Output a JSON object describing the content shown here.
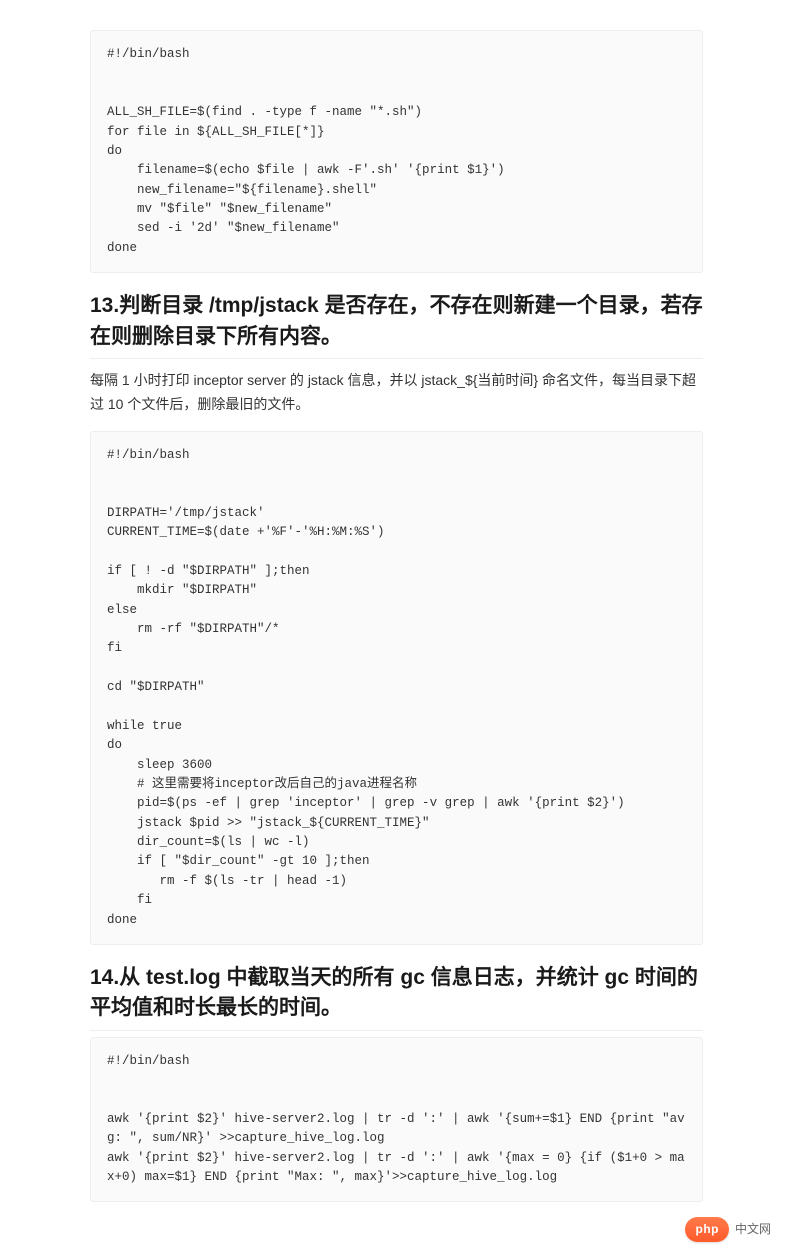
{
  "codeblocks": {
    "block1": "#!/bin/bash\n\n\nALL_SH_FILE=$(find . -type f -name \"*.sh\")\nfor file in ${ALL_SH_FILE[*]}\ndo\n    filename=$(echo $file | awk -F'.sh' '{print $1}')\n    new_filename=\"${filename}.shell\"\n    mv \"$file\" \"$new_filename\"\n    sed -i '2d' \"$new_filename\"\ndone",
    "block2": "#!/bin/bash\n\n\nDIRPATH='/tmp/jstack'\nCURRENT_TIME=$(date +'%F'-'%H:%M:%S')\n\nif [ ! -d \"$DIRPATH\" ];then\n    mkdir \"$DIRPATH\"\nelse\n    rm -rf \"$DIRPATH\"/*\nfi\n\ncd \"$DIRPATH\"\n\nwhile true\ndo\n    sleep 3600\n    # 这里需要将inceptor改后自己的java进程名称\n    pid=$(ps -ef | grep 'inceptor' | grep -v grep | awk '{print $2}')\n    jstack $pid >> \"jstack_${CURRENT_TIME}\"\n    dir_count=$(ls | wc -l)\n    if [ \"$dir_count\" -gt 10 ];then\n       rm -f $(ls -tr | head -1)\n    fi\ndone",
    "block3": "#!/bin/bash\n\n\nawk '{print $2}' hive-server2.log | tr -d ':' | awk '{sum+=$1} END {print \"avg: \", sum/NR}' >>capture_hive_log.log\nawk '{print $2}' hive-server2.log | tr -d ':' | awk '{max = 0} {if ($1+0 > max+0) max=$1} END {print \"Max: \", max}'>>capture_hive_log.log"
  },
  "sections": {
    "s13": {
      "heading": "13.判断目录 /tmp/jstack 是否存在，不存在则新建一个目录，若存在则删除目录下所有内容。",
      "desc": "每隔 1 小时打印 inceptor server 的 jstack 信息，并以 jstack_${当前时间} 命名文件，每当目录下超过 10 个文件后，删除最旧的文件。"
    },
    "s14": {
      "heading": "14.从 test.log 中截取当天的所有 gc 信息日志，并统计 gc 时间的平均值和时长最长的时间。"
    }
  },
  "brand": {
    "pill": "php",
    "text": "中文网"
  }
}
